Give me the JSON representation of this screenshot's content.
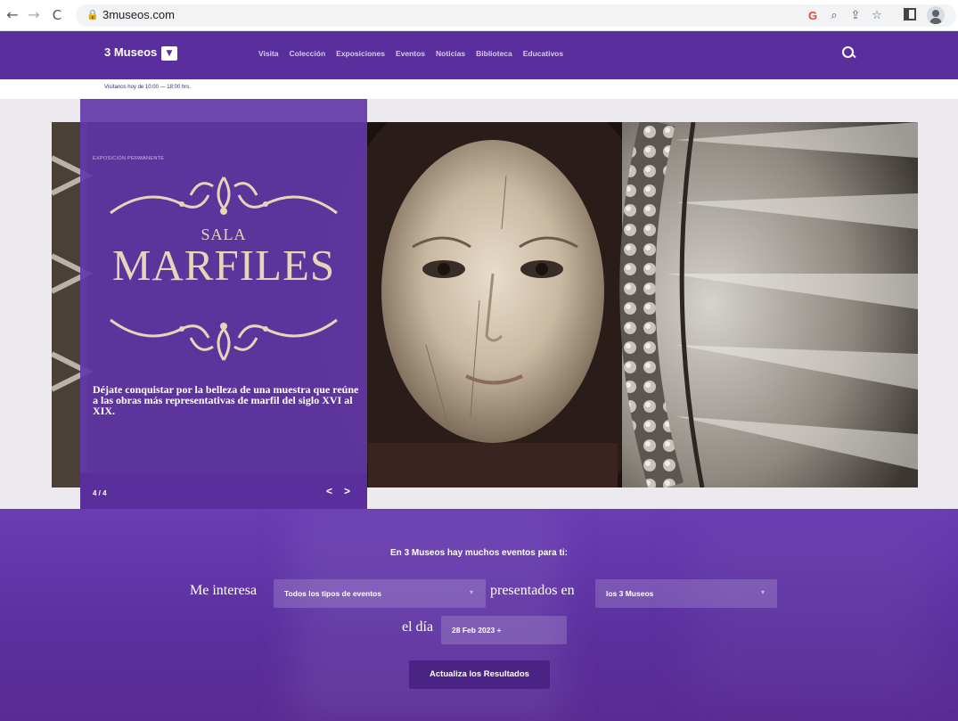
{
  "browser": {
    "url": "3museos.com",
    "icons": [
      "back-icon",
      "forward-icon",
      "reload-icon",
      "lock-icon",
      "google-lens-icon",
      "zoom-icon",
      "share-icon",
      "bookmark-star-icon",
      "side-panel-icon",
      "profile-icon"
    ]
  },
  "header": {
    "brand": "3 Museos",
    "nav": [
      "Visita",
      "Colección",
      "Exposiciones",
      "Eventos",
      "Noticias",
      "Biblioteca",
      "Educativos"
    ],
    "hours": "Visítanos hoy de 10:00 — 18:00 hrs."
  },
  "slide": {
    "eyebrow": "EXPOSICIÓN PERMANENTE",
    "subtitle": "SALA",
    "title": "MARFILES",
    "description": "Déjate conquistar por la belleza de una muestra que reúne a las obras más representativas de marfil del siglo XVI al XIX.",
    "counter": "4 / 4",
    "prev_label": "<",
    "next_label": ">"
  },
  "events": {
    "heading": "En 3 Museos hay muchos eventos para ti:",
    "interest_label": "Me interesa",
    "type_select": "Todos los tipos de eventos",
    "presented_label": "presentados en",
    "museum_select": "los 3 Museos",
    "day_label": "el día",
    "date_value": "28 Feb 2023 +",
    "update_button": "Actualiza los Resultados"
  },
  "colors": {
    "brand_purple": "#5a2e9c",
    "card_purple": "#6237a8",
    "title_cream": "#e6d6b8"
  }
}
